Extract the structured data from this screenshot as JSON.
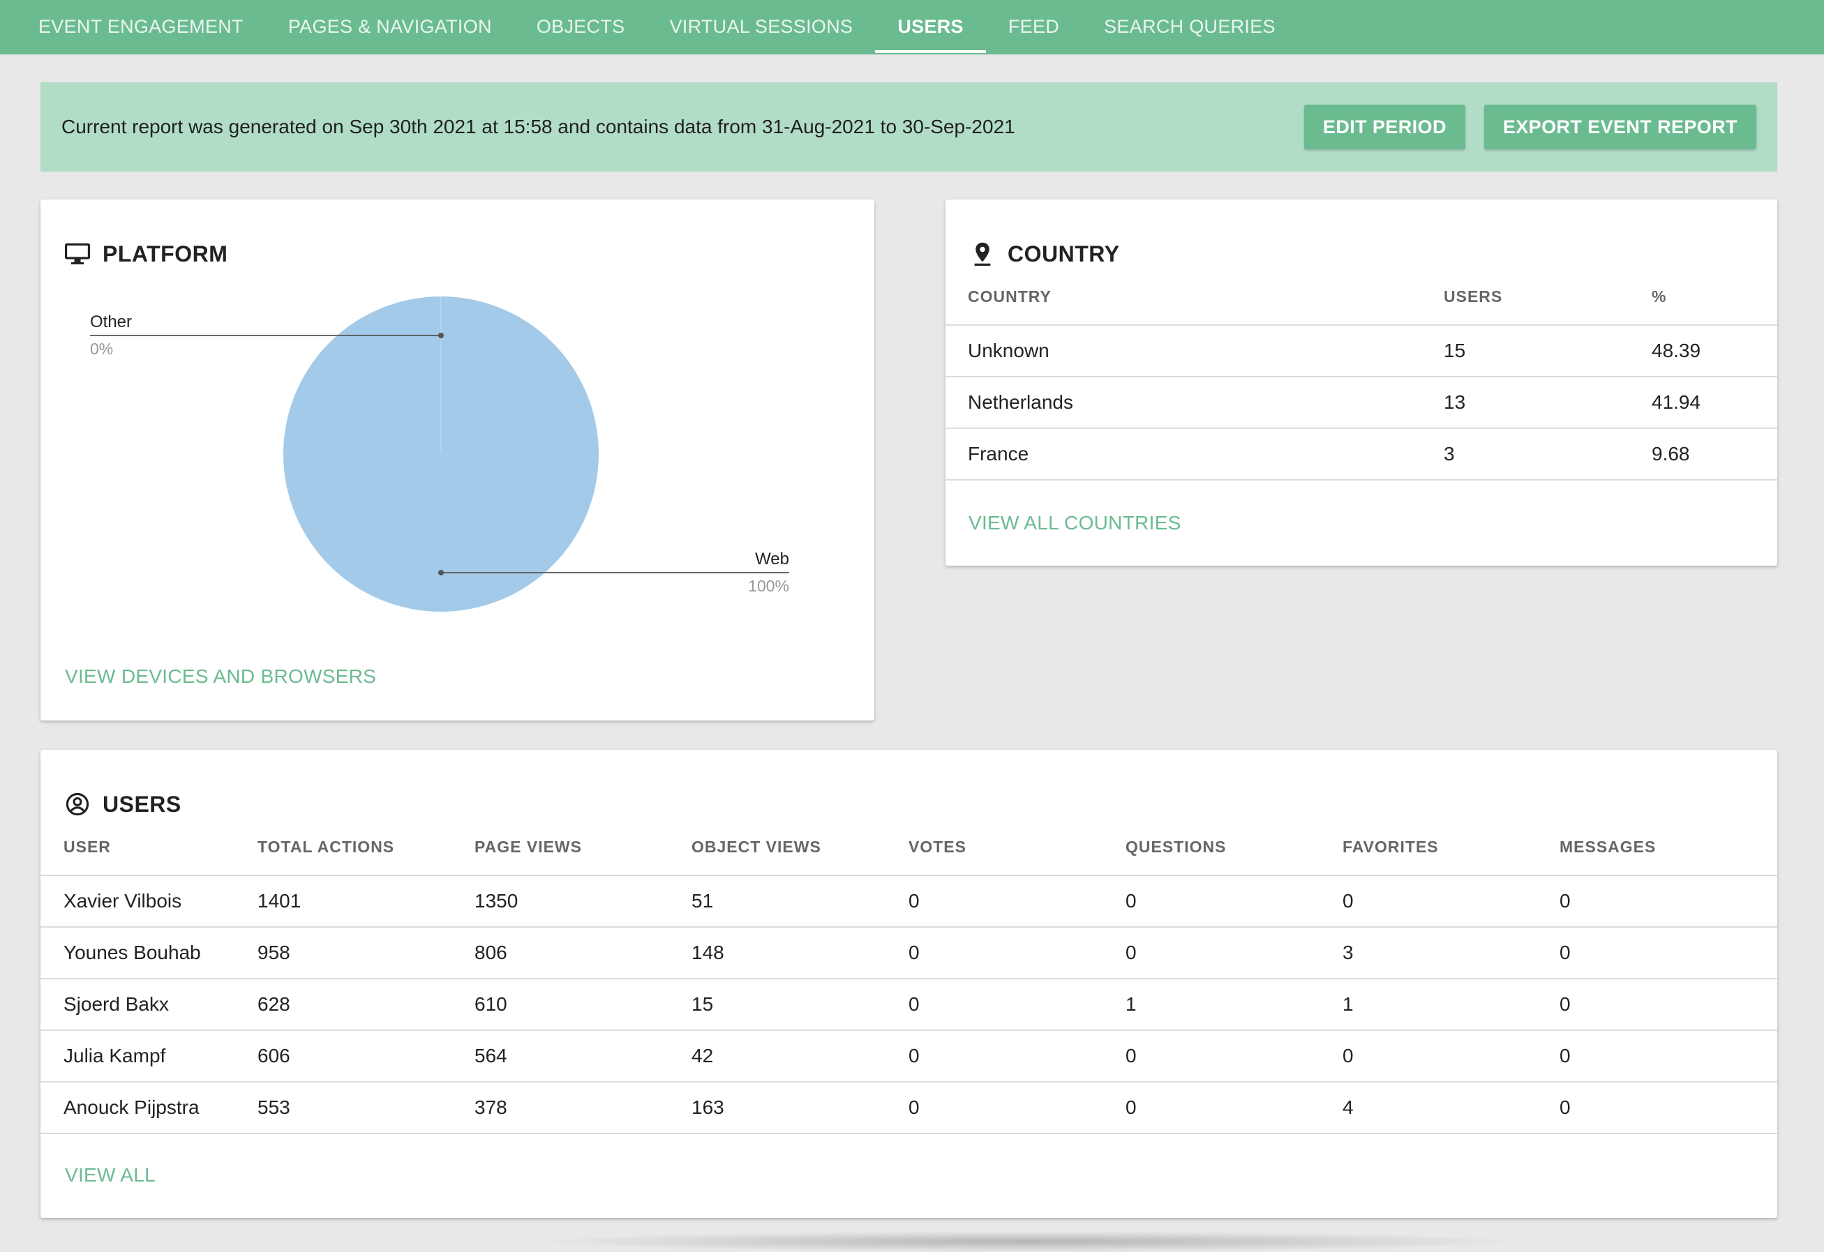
{
  "tabs": [
    {
      "label": "EVENT ENGAGEMENT",
      "active": false
    },
    {
      "label": "PAGES & NAVIGATION",
      "active": false
    },
    {
      "label": "OBJECTS",
      "active": false
    },
    {
      "label": "VIRTUAL SESSIONS",
      "active": false
    },
    {
      "label": "USERS",
      "active": true
    },
    {
      "label": "FEED",
      "active": false
    },
    {
      "label": "SEARCH QUERIES",
      "active": false
    }
  ],
  "banner": {
    "text": "Current report was generated on Sep 30th 2021 at 15:58 and contains data from 31-Aug-2021 to 30-Sep-2021",
    "edit_label": "EDIT PERIOD",
    "export_label": "EXPORT EVENT REPORT"
  },
  "platform": {
    "title": "PLATFORM",
    "icon": "monitor-icon",
    "link": "VIEW DEVICES AND BROWSERS",
    "chart_data": {
      "type": "pie",
      "slices": [
        {
          "label": "Other",
          "value": 0,
          "display": "0%"
        },
        {
          "label": "Web",
          "value": 100,
          "display": "100%"
        }
      ],
      "color": "#a3cae8"
    }
  },
  "country": {
    "title": "COUNTRY",
    "icon": "location-pin-icon",
    "columns": [
      "COUNTRY",
      "USERS",
      "%"
    ],
    "rows": [
      [
        "Unknown",
        "15",
        "48.39"
      ],
      [
        "Netherlands",
        "13",
        "41.94"
      ],
      [
        "France",
        "3",
        "9.68"
      ]
    ],
    "link": "VIEW ALL COUNTRIES"
  },
  "users": {
    "title": "USERS",
    "icon": "user-circle-icon",
    "columns": [
      "USER",
      "TOTAL ACTIONS",
      "PAGE VIEWS",
      "OBJECT VIEWS",
      "VOTES",
      "QUESTIONS",
      "FAVORITES",
      "MESSAGES"
    ],
    "rows": [
      [
        "Xavier Vilbois",
        "1401",
        "1350",
        "51",
        "0",
        "0",
        "0",
        "0"
      ],
      [
        "Younes Bouhab",
        "958",
        "806",
        "148",
        "0",
        "0",
        "3",
        "0"
      ],
      [
        "Sjoerd Bakx",
        "628",
        "610",
        "15",
        "0",
        "1",
        "1",
        "0"
      ],
      [
        "Julia Kampf",
        "606",
        "564",
        "42",
        "0",
        "0",
        "0",
        "0"
      ],
      [
        "Anouck Pijpstra",
        "553",
        "378",
        "163",
        "0",
        "0",
        "4",
        "0"
      ]
    ],
    "link": "VIEW ALL"
  },
  "colors": {
    "accent": "#6bbb91",
    "banner_bg": "#b1dcc6",
    "pie": "#a3cae8"
  }
}
